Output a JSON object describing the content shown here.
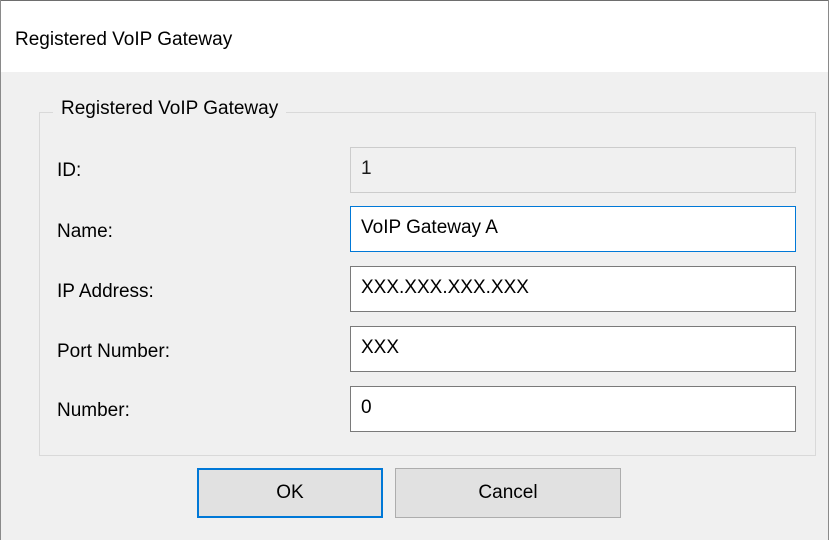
{
  "window": {
    "title": "Registered VoIP Gateway"
  },
  "group": {
    "legend": "Registered VoIP Gateway"
  },
  "fields": {
    "id": {
      "label": "ID:",
      "value": "1"
    },
    "name": {
      "label": "Name:",
      "value": "VoIP Gateway A"
    },
    "ip_address": {
      "label": "IP Address:",
      "value": "XXX.XXX.XXX.XXX"
    },
    "port_number": {
      "label": "Port Number:",
      "value": "XXX"
    },
    "number": {
      "label": "Number:",
      "value": "0"
    }
  },
  "buttons": {
    "ok": "OK",
    "cancel": "Cancel"
  },
  "colors": {
    "focus_accent": "#0078d7",
    "dialog_bg": "#f0f0f0"
  }
}
